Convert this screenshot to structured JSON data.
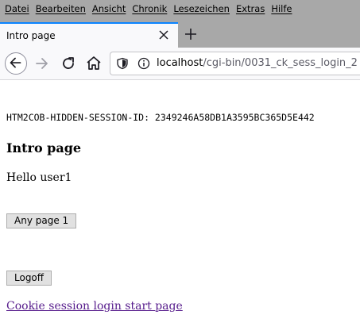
{
  "menubar": {
    "items": [
      "Datei",
      "Bearbeiten",
      "Ansicht",
      "Chronik",
      "Lesezeichen",
      "Extras",
      "Hilfe"
    ]
  },
  "tab": {
    "title": "Intro page"
  },
  "navbar": {
    "url_host": "localhost",
    "url_path": "/cgi-bin/0031_ck_sess_login_2"
  },
  "page": {
    "session_id_line": "HTM2COB-HIDDEN-SESSION-ID: 2349246A58DB1A3595BC365D5E442",
    "title": "Intro page",
    "greeting": "Hello user1",
    "any_page_button": "Any page 1",
    "logoff_button": "Logoff",
    "start_link": "Cookie session login start page"
  },
  "colors": {
    "chrome_gray": "#a8a8a8",
    "tab_accent": "#0a84ff",
    "visited_link": "#551a8b"
  },
  "icons": [
    "close-icon",
    "plus-icon",
    "back-arrow-icon",
    "forward-arrow-icon",
    "reload-icon",
    "home-icon",
    "shield-icon",
    "info-icon"
  ]
}
